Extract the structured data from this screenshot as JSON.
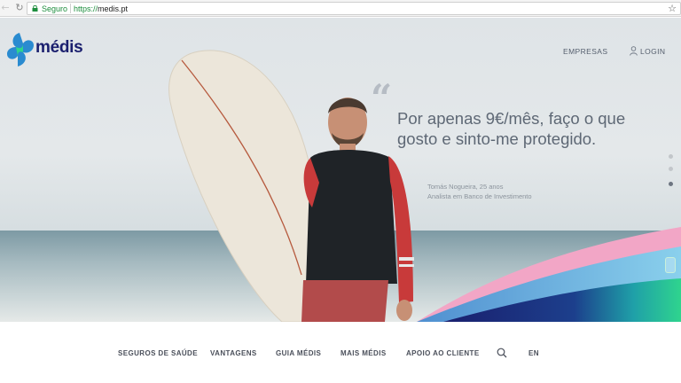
{
  "browser": {
    "secure_label": "Seguro",
    "url_scheme": "https://",
    "url_host": "medis.pt",
    "icons": [
      "back-arrow-icon",
      "reload-icon",
      "lock-icon",
      "star-icon"
    ]
  },
  "header": {
    "logo_text": "médis",
    "links": {
      "empresas": "EMPRESAS",
      "login": "LOGIN"
    }
  },
  "hero": {
    "quote": "Por apenas 9€/mês, faço o que gosto e sinto-me protegido.",
    "author_name": "Tomás Nogueira, 25 anos",
    "author_role": "Analista em Banco de Investimento",
    "slides_total": 3,
    "active_slide": 3
  },
  "nav": {
    "items": [
      "SEGUROS DE SAÚDE",
      "VANTAGENS",
      "GUIA MÉDIS",
      "MAIS MÉDIS",
      "APOIO AO CLIENTE"
    ],
    "language": "EN"
  },
  "colors": {
    "brand_navy": "#1a1f6e",
    "brand_blue": "#2a8bd0",
    "brand_green": "#2fd48e",
    "wave_pink": "#f2a6c6",
    "secure_green": "#1e8e3e"
  }
}
